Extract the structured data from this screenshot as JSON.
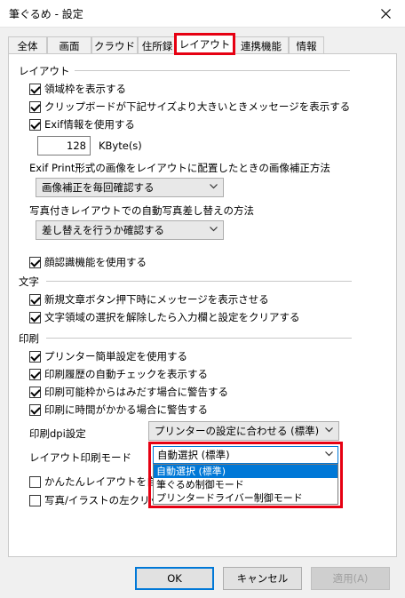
{
  "window": {
    "title": "筆ぐるめ - 設定"
  },
  "tabs": [
    "全体",
    "画面",
    "クラウド",
    "住所録",
    "レイアウト",
    "連携機能",
    "情報"
  ],
  "sections": {
    "layout": "レイアウト",
    "text": "文字",
    "print": "印刷"
  },
  "layout": {
    "show_area_frame": "領域枠を表示する",
    "clipboard_message": "クリップボードが下記サイズより大きいときメッセージを表示する",
    "use_exif": "Exif情報を使用する",
    "size_value": "128",
    "size_unit": "KByte(s)",
    "exif_print_label": "Exif Print形式の画像をレイアウトに配置したときの画像補正方法",
    "exif_print_select": "画像補正を毎回確認する",
    "photo_replace_label": "写真付きレイアウトでの自動写真差し替えの方法",
    "photo_replace_select": "差し替えを行うか確認する",
    "face_recognition": "顔認識機能を使用する"
  },
  "text": {
    "new_text_message": "新規文章ボタン押下時にメッセージを表示させる",
    "clear_input_settings": "文字領域の選択を解除したら入力欄と設定をクリアする"
  },
  "print": {
    "simple_printer": "プリンター簡単設定を使用する",
    "auto_check_history": "印刷履歴の自動チェックを表示する",
    "warn_outside_area": "印刷可能枠からはみだす場合に警告する",
    "warn_long_time": "印刷に時間がかかる場合に警告する",
    "dpi_label": "印刷dpi設定",
    "dpi_select": "プリンターの設定に合わせる (標準)",
    "mode_label": "レイアウト印刷モード",
    "mode_select": "自動選択 (標準)",
    "mode_options": [
      "自動選択 (標準)",
      "筆ぐるめ制御モード",
      "プリンタードライバー制御モード"
    ],
    "easy_layout_partial": "かんたんレイアウトを自動",
    "photo_left_click_partial": "写真/イラストの左クリック"
  },
  "buttons": {
    "ok": "OK",
    "cancel": "キャンセル",
    "apply": "適用(A)"
  },
  "colors": {
    "highlight": "#e60012",
    "selection": "#0078d7"
  }
}
